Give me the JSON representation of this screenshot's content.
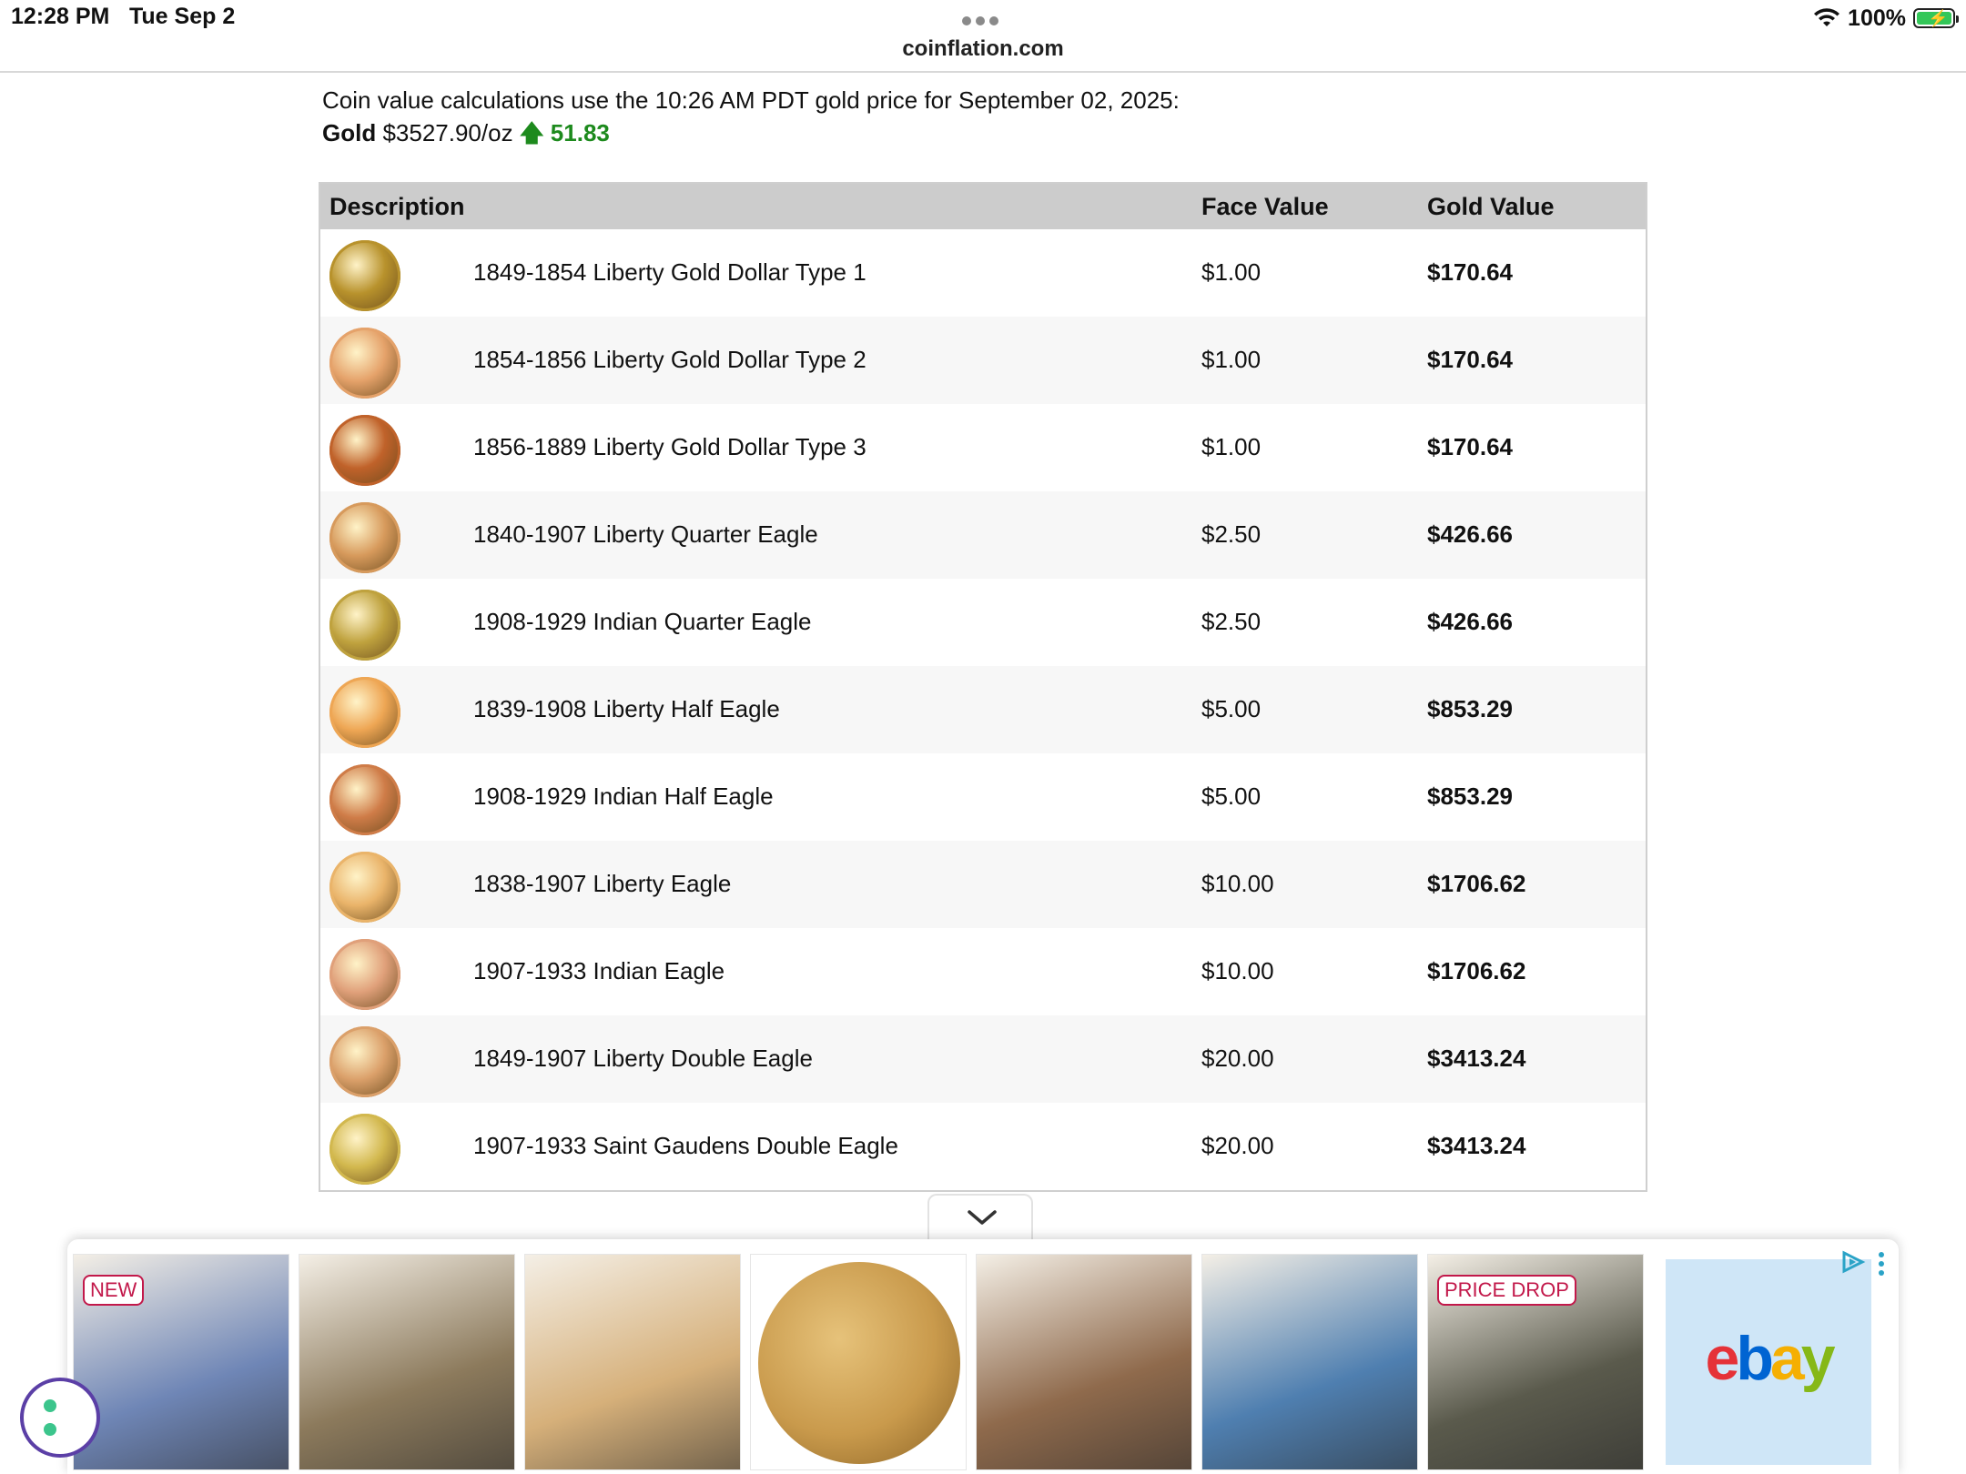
{
  "status_bar": {
    "time": "12:28 PM",
    "date": "Tue Sep 2",
    "battery": "100%",
    "url": "coinflation.com"
  },
  "intro": {
    "line1": "Coin value calculations use the 10:26 AM PDT gold price for September 02, 2025:",
    "gold_label": "Gold",
    "gold_price": "$3527.90/oz",
    "change": "51.83",
    "change_direction": "up",
    "change_color": "#1d8a1d"
  },
  "table": {
    "headers": {
      "description": "Description",
      "face": "Face Value",
      "gold": "Gold Value"
    },
    "rows": [
      {
        "description": "1849-1854 Liberty Gold Dollar Type 1",
        "face": "$1.00",
        "gold": "$170.64",
        "coin_color": "#b8922c"
      },
      {
        "description": "1854-1856 Liberty Gold Dollar Type 2",
        "face": "$1.00",
        "gold": "$170.64",
        "coin_color": "#e5a26a"
      },
      {
        "description": "1856-1889 Liberty Gold Dollar Type 3",
        "face": "$1.00",
        "gold": "$170.64",
        "coin_color": "#c0622a"
      },
      {
        "description": "1840-1907 Liberty Quarter Eagle",
        "face": "$2.50",
        "gold": "$426.66",
        "coin_color": "#d79a5c"
      },
      {
        "description": "1908-1929 Indian Quarter Eagle",
        "face": "$2.50",
        "gold": "$426.66",
        "coin_color": "#bfa23e"
      },
      {
        "description": "1839-1908 Liberty Half Eagle",
        "face": "$5.00",
        "gold": "$853.29",
        "coin_color": "#eea654"
      },
      {
        "description": "1908-1929 Indian Half Eagle",
        "face": "$5.00",
        "gold": "$853.29",
        "coin_color": "#cf7c48"
      },
      {
        "description": "1838-1907 Liberty Eagle",
        "face": "$10.00",
        "gold": "$1706.62",
        "coin_color": "#eab46a"
      },
      {
        "description": "1907-1933 Indian Eagle",
        "face": "$10.00",
        "gold": "$1706.62",
        "coin_color": "#e0a07a"
      },
      {
        "description": "1849-1907 Liberty Double Eagle",
        "face": "$20.00",
        "gold": "$3413.24",
        "coin_color": "#dba06a"
      },
      {
        "description": "1907-1933 Saint Gaudens Double Eagle",
        "face": "$20.00",
        "gold": "$3413.24",
        "coin_color": "#d2b84e"
      }
    ]
  },
  "ads": {
    "badges": {
      "new": "NEW",
      "price_drop": "PRICE DROP"
    },
    "tiles": [
      {
        "name": "signed-photo",
        "color": "#6f86b6"
      },
      {
        "name": "portrait-photo",
        "color": "#8c7a5c"
      },
      {
        "name": "doll-head",
        "color": "#d6b07a"
      },
      {
        "name": "wheat-penny",
        "color": "#c99a4c"
      },
      {
        "name": "tool-handle",
        "color": "#8f6a4c"
      },
      {
        "name": "car-interior",
        "color": "#4f7fb0"
      },
      {
        "name": "godzilla-figure",
        "color": "#5a5a4c"
      }
    ],
    "brand": "ebay"
  }
}
